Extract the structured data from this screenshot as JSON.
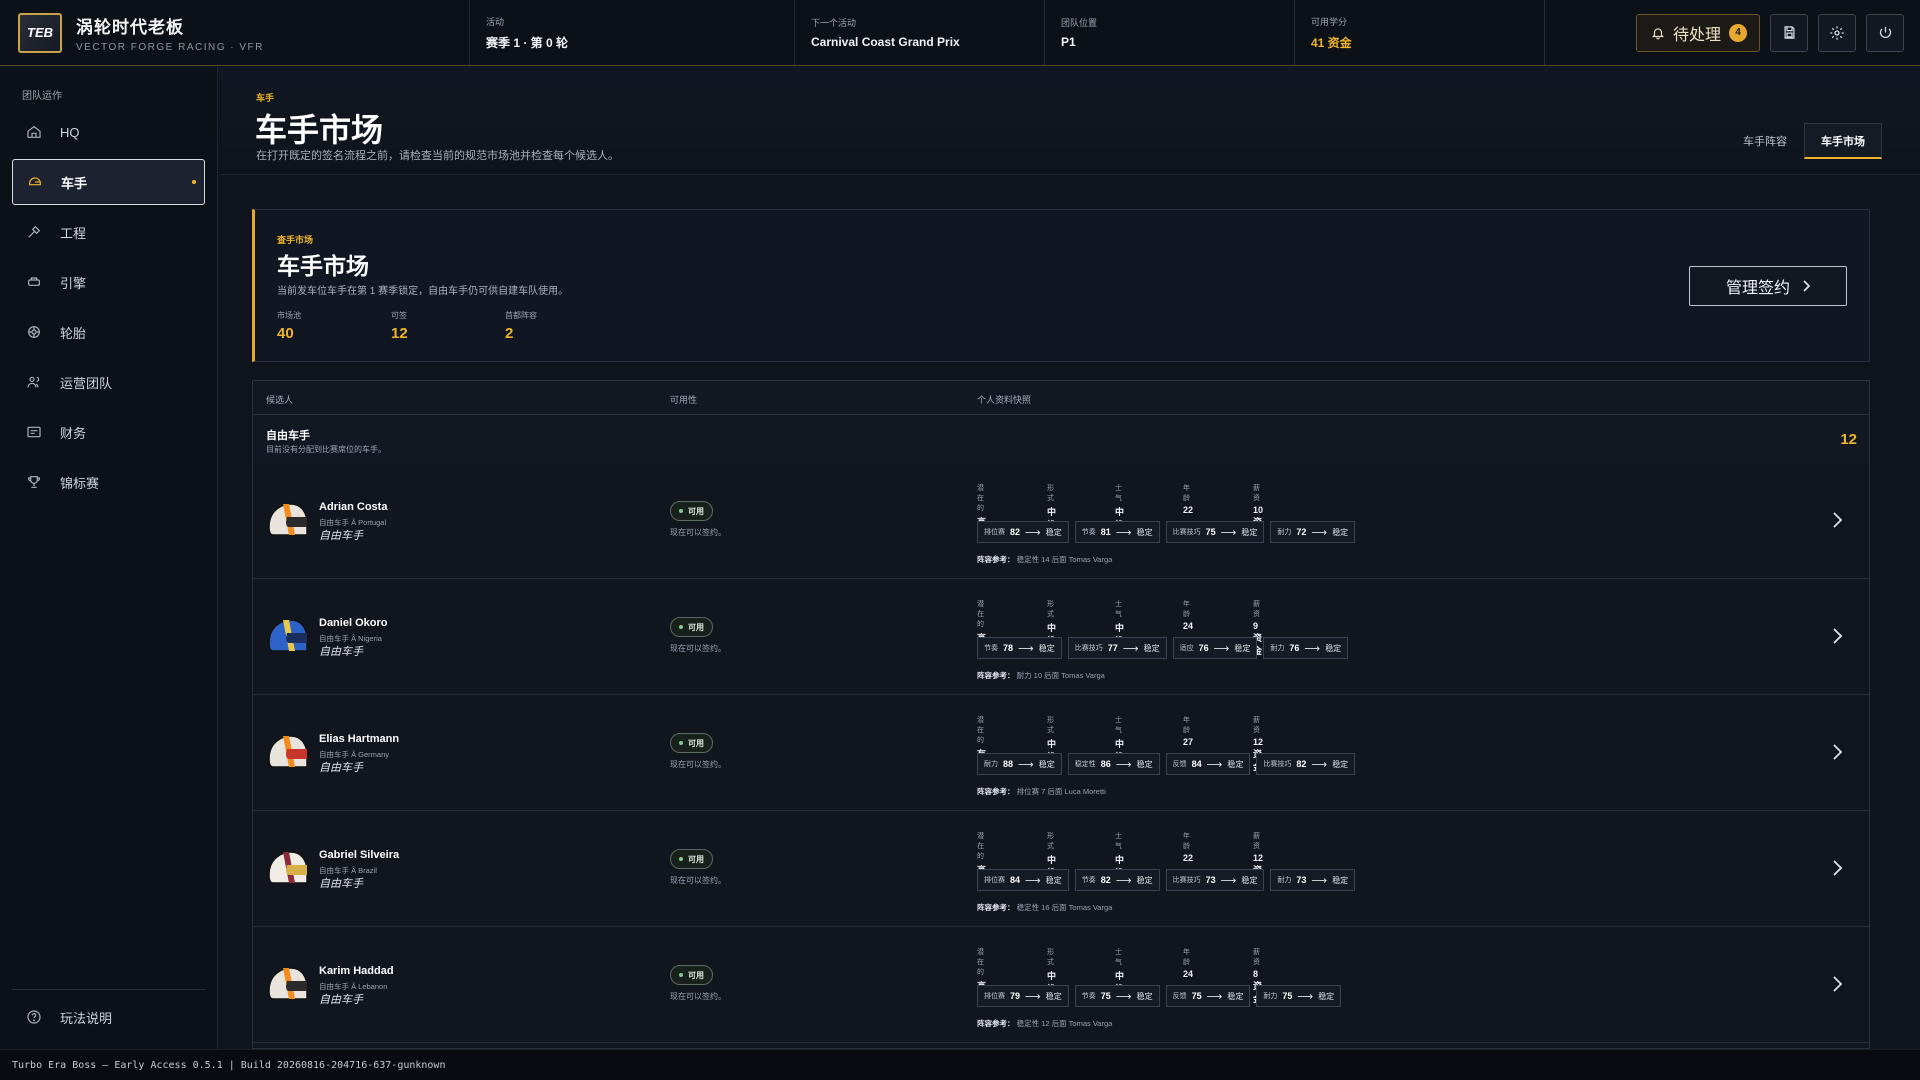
{
  "app": {
    "logo_text": "TEB",
    "title": "涡轮时代老板",
    "subtitle": "VECTOR FORGE RACING · VFR"
  },
  "topbar": {
    "stats": [
      {
        "label": "活动",
        "value": "赛季 1 · 第 0 轮"
      },
      {
        "label": "下一个活动",
        "value": "Carnival Coast Grand Prix"
      },
      {
        "label": "团队位置",
        "value": "P1"
      },
      {
        "label": "可用学分",
        "value": "41 资金"
      }
    ],
    "pending_label": "待处理",
    "pending_count": "4"
  },
  "sidebar": {
    "section": "团队运作",
    "items": [
      {
        "label": "HQ",
        "icon": "home-icon"
      },
      {
        "label": "车手",
        "icon": "helmet-icon"
      },
      {
        "label": "工程",
        "icon": "wrench-icon"
      },
      {
        "label": "引擎",
        "icon": "engine-icon"
      },
      {
        "label": "轮胎",
        "icon": "tire-icon"
      },
      {
        "label": "运营团队",
        "icon": "team-icon"
      },
      {
        "label": "财务",
        "icon": "finance-icon"
      },
      {
        "label": "锦标赛",
        "icon": "trophy-icon"
      }
    ],
    "help_label": "玩法说明"
  },
  "page": {
    "eyebrow": "车手",
    "title": "车手市场",
    "description": "在打开既定的签名流程之前，请检查当前的规范市场池并检查每个候选人。",
    "tabs": [
      {
        "label": "车手阵容",
        "active": false
      },
      {
        "label": "车手市场",
        "active": true
      }
    ]
  },
  "market": {
    "eyebrow": "查手市场",
    "title": "车手市场",
    "description": "当前发车位车手在第 1 赛季锁定，自由车手仍可供自建车队使用。",
    "stats": [
      {
        "label": "市场池",
        "value": "40"
      },
      {
        "label": "可签",
        "value": "12"
      },
      {
        "label": "首都阵容",
        "value": "2"
      }
    ],
    "manage_label": "管理签约"
  },
  "table": {
    "headers": [
      "候选人",
      "可用性",
      "个人资料快照"
    ],
    "group": {
      "title": "自由车手",
      "description": "目前没有分配到比赛席位的车手。",
      "count": "12"
    },
    "attr_labels": [
      "潜在的",
      "形式",
      "士气",
      "年龄",
      "薪资"
    ],
    "ref_label": "阵容参考：",
    "rows": [
      {
        "name": "Adrian Costa",
        "sub": "自由车手 Â Portugal",
        "role": "自由车手",
        "avail": "可用",
        "note": "现在可以签约。",
        "attrs": [
          "高",
          "中性",
          "中性",
          "22",
          "10 资金"
        ],
        "skills": [
          {
            "label": "排位赛",
            "value": "82",
            "state": "稳定"
          },
          {
            "label": "节奏",
            "value": "81",
            "state": "稳定"
          },
          {
            "label": "比赛技巧",
            "value": "75",
            "state": "稳定"
          },
          {
            "label": "耐力",
            "value": "72",
            "state": "稳定"
          }
        ],
        "ref": "稳定性 14 后面 Tomas Varga",
        "helmet": [
          "#e8e4dc",
          "#f28c1e",
          "#2a2a2a"
        ]
      },
      {
        "name": "Daniel Okoro",
        "sub": "自由车手 Â Nigeria",
        "role": "自由车手",
        "avail": "可用",
        "note": "现在可以签约。",
        "attrs": [
          "高",
          "中性",
          "中性",
          "24",
          "9 资金"
        ],
        "skills": [
          {
            "label": "节奏",
            "value": "78",
            "state": "稳定"
          },
          {
            "label": "比赛技巧",
            "value": "77",
            "state": "稳定"
          },
          {
            "label": "适应",
            "value": "76",
            "state": "稳定"
          },
          {
            "label": "耐力",
            "value": "76",
            "state": "稳定"
          }
        ],
        "ref": "耐力 10 后面 Tomas Varga",
        "helmet": [
          "#2d63c8",
          "#e8c94a",
          "#1b2f5e"
        ]
      },
      {
        "name": "Elias Hartmann",
        "sub": "自由车手 Â Germany",
        "role": "自由车手",
        "avail": "可用",
        "note": "现在可以签约。",
        "attrs": [
          "有限",
          "中性",
          "中性",
          "27",
          "12 资金"
        ],
        "skills": [
          {
            "label": "耐力",
            "value": "88",
            "state": "稳定"
          },
          {
            "label": "稳定性",
            "value": "86",
            "state": "稳定"
          },
          {
            "label": "反馈",
            "value": "84",
            "state": "稳定"
          },
          {
            "label": "比赛技巧",
            "value": "82",
            "state": "稳定"
          }
        ],
        "ref": "排位赛 7 后面 Luca Moretti",
        "helmet": [
          "#e8e4dc",
          "#f28c1e",
          "#c8352a"
        ]
      },
      {
        "name": "Gabriel Silveira",
        "sub": "自由车手 Â Brazil",
        "role": "自由车手",
        "avail": "可用",
        "note": "现在可以签约。",
        "attrs": [
          "高",
          "中性",
          "中性",
          "22",
          "12 资金"
        ],
        "skills": [
          {
            "label": "排位赛",
            "value": "84",
            "state": "稳定"
          },
          {
            "label": "节奏",
            "value": "82",
            "state": "稳定"
          },
          {
            "label": "比赛技巧",
            "value": "73",
            "state": "稳定"
          },
          {
            "label": "耐力",
            "value": "73",
            "state": "稳定"
          }
        ],
        "ref": "稳定性 16 后面 Tomas Varga",
        "helmet": [
          "#f1ede6",
          "#8a2a3a",
          "#d8b04a"
        ]
      },
      {
        "name": "Karim Haddad",
        "sub": "自由车手 Â Lebanon",
        "role": "自由车手",
        "avail": "可用",
        "note": "现在可以签约。",
        "attrs": [
          "高",
          "中性",
          "中性",
          "24",
          "8 资金"
        ],
        "skills": [
          {
            "label": "排位赛",
            "value": "79",
            "state": "稳定"
          },
          {
            "label": "节奏",
            "value": "75",
            "state": "稳定"
          },
          {
            "label": "反馈",
            "value": "75",
            "state": "稳定"
          },
          {
            "label": "耐力",
            "value": "75",
            "state": "稳定"
          }
        ],
        "ref": "稳定性 12 后面 Tomas Varga",
        "helmet": [
          "#e8e4dc",
          "#f28c1e",
          "#2a2a2a"
        ]
      }
    ]
  },
  "footer": {
    "text": "Turbo Era Boss — Early Access 0.5.1 | Build 20260816-204716-637-gunknown"
  }
}
